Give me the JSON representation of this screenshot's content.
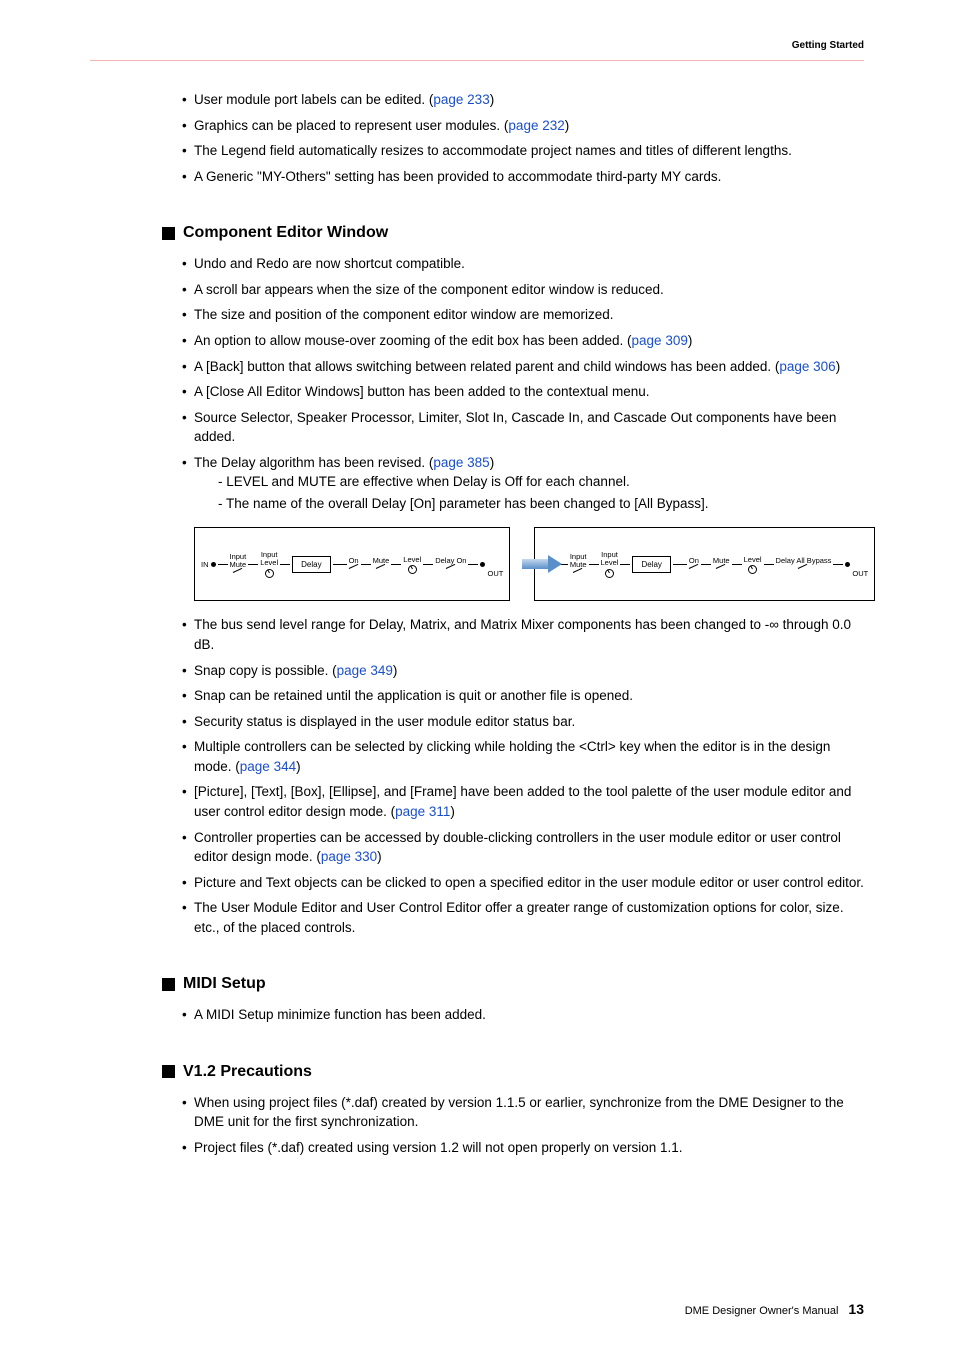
{
  "header": {
    "chapter": "Getting Started"
  },
  "footer": {
    "manual": "DME Designer Owner's Manual",
    "page": "13"
  },
  "top_bullets": [
    {
      "pre": "User module port labels can be edited. (",
      "link": "page 233",
      "post": ")"
    },
    {
      "pre": "Graphics can be placed to represent user modules. (",
      "link": "page 232",
      "post": ")"
    },
    {
      "pre": "The Legend field automatically resizes to accommodate project names and titles of different lengths."
    },
    {
      "pre": "A Generic \"MY-Others\" setting has been provided to accommodate third-party MY cards."
    }
  ],
  "sections": {
    "component": {
      "title": "Component Editor Window",
      "bullets1": [
        {
          "pre": "Undo and Redo are now shortcut compatible."
        },
        {
          "pre": "A scroll bar appears when the size of the component editor window is reduced."
        },
        {
          "pre": "The size and position of the component editor window are memorized."
        },
        {
          "pre": "An option to allow mouse-over zooming of the edit box has been added. (",
          "link": "page 309",
          "post": ")"
        },
        {
          "pre": "A [Back] button that allows switching between related parent and child windows has been added. (",
          "link": "page 306",
          "post": ")"
        },
        {
          "pre": "A [Close All Editor Windows] button has been added to the contextual menu."
        },
        {
          "pre": "Source Selector, Speaker Processor, Limiter, Slot In, Cascade In, and Cascade Out components have been added."
        },
        {
          "pre": "The Delay algorithm has been revised. (",
          "link": "page 385",
          "post": ")",
          "subs": [
            "- LEVEL and MUTE are effective when Delay is Off for each channel.",
            "- The name of the overall Delay [On] parameter has been changed to [All Bypass]."
          ]
        }
      ],
      "diagram": {
        "in_label": "IN",
        "out_label": "OUT",
        "input_mute": "Input\nMute",
        "input_level": "Input\nLevel",
        "delay_box": "Delay",
        "on_label": "On",
        "mute_label": "Mute",
        "level_label": "Level",
        "delay_on": "Delay On",
        "delay_all_bypass": "Delay All Bypass"
      },
      "bullets2": [
        {
          "pre": "The bus send level range for Delay, Matrix, and Matrix Mixer components has been changed to -∞ through 0.0 dB."
        },
        {
          "pre": "Snap copy is possible. (",
          "link": "page 349",
          "post": ")"
        },
        {
          "pre": "Snap can be retained until the application is quit or another file is opened."
        },
        {
          "pre": "Security status is displayed in the user module editor status bar."
        },
        {
          "pre": "Multiple controllers can be selected by clicking while holding the <Ctrl> key when the editor is in the design mode. (",
          "link": "page 344",
          "post": ")"
        },
        {
          "pre": "[Picture], [Text], [Box], [Ellipse], and [Frame] have been added to the tool palette of the user module editor and user control editor design mode. (",
          "link": "page 311",
          "post": ")"
        },
        {
          "pre": "Controller properties can be accessed by double-clicking controllers in the user module editor or user control editor design mode. (",
          "link": "page 330",
          "post": ")"
        },
        {
          "pre": "Picture and Text objects can be clicked to open a specified editor in the user module editor or user control editor."
        },
        {
          "pre": "The User Module Editor and User Control Editor offer a greater range of customization options for color, size. etc., of the placed controls."
        }
      ]
    },
    "midi": {
      "title": "MIDI Setup",
      "bullets": [
        {
          "pre": "A MIDI Setup minimize function has been added."
        }
      ]
    },
    "precautions": {
      "title": "V1.2 Precautions",
      "bullets": [
        {
          "pre": "When using project files (*.daf) created by version 1.1.5 or earlier, synchronize from the DME Designer to the DME unit for the first synchronization."
        },
        {
          "pre": "Project files (*.daf) created using version 1.2 will not open properly on version 1.1."
        }
      ]
    }
  }
}
